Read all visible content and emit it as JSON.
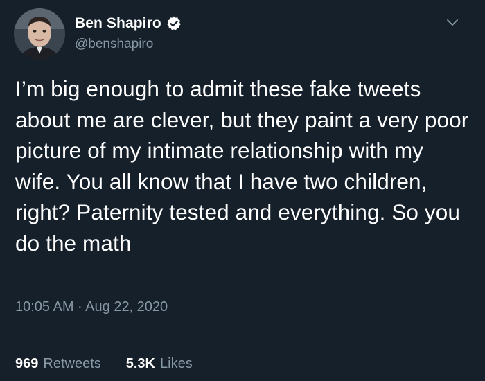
{
  "author": {
    "name": "Ben Shapiro",
    "handle": "@benshapiro",
    "verified": true,
    "avatar_icon": "user-avatar",
    "verified_icon": "verified-badge-icon"
  },
  "menu_icon": "chevron-down-icon",
  "tweet": {
    "text": "I’m big enough to admit these fake tweets about me are clever, but they paint a very poor picture of my intimate relationship with my wife. You all know that I have two children, right? Paternity tested and everything. So you do the math",
    "timestamp": "10:05 AM · Aug 22, 2020"
  },
  "stats": {
    "retweets_count": "969",
    "retweets_label": "Retweets",
    "likes_count": "5.3K",
    "likes_label": "Likes"
  },
  "colors": {
    "background": "#15202b",
    "text_primary": "#ffffff",
    "text_secondary": "#8899a6",
    "divider": "#38444d"
  }
}
